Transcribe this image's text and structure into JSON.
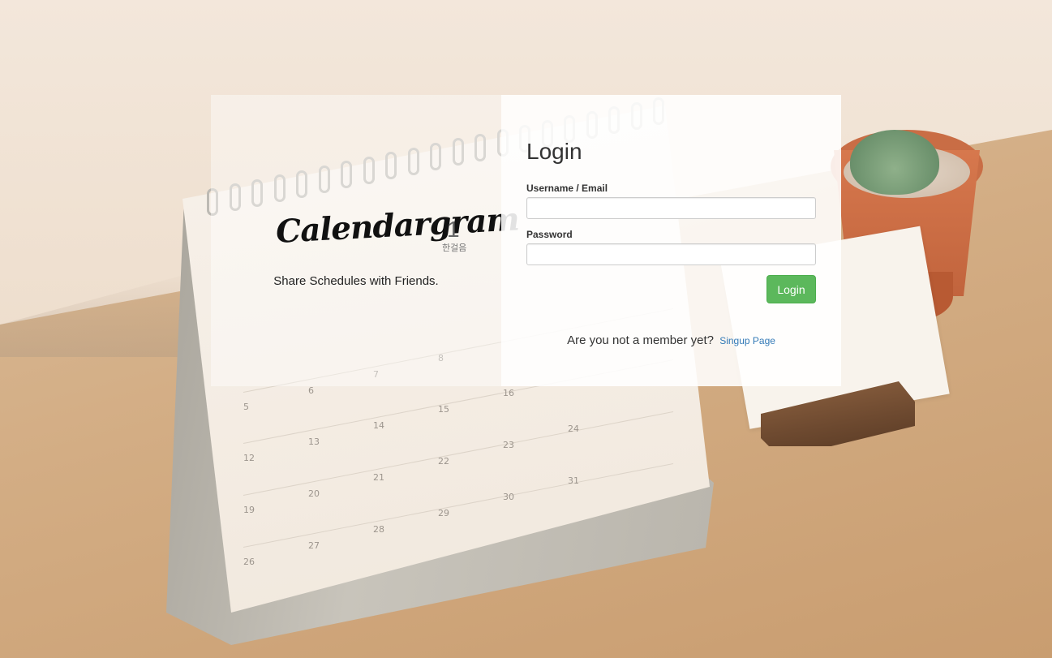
{
  "brand": {
    "logo_text": "Calendargram",
    "logo_number": "1",
    "logo_sub": "한걸음",
    "tagline": "Share Schedules with Friends."
  },
  "login": {
    "title": "Login",
    "username_label": "Username / Email",
    "username_value": "",
    "password_label": "Password",
    "password_value": "",
    "submit_label": "Login"
  },
  "signup": {
    "prompt": "Are you not a member yet?",
    "link_label": "Singup Page"
  },
  "colors": {
    "primary_button": "#5cb85c",
    "link": "#337ab7"
  }
}
